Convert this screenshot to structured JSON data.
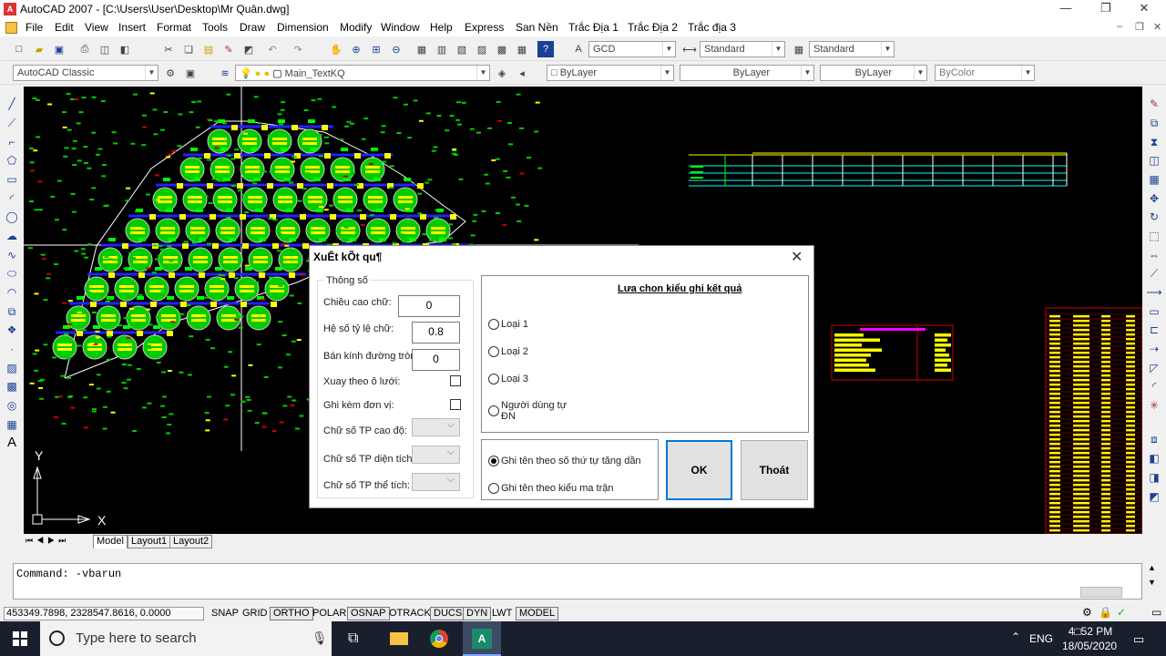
{
  "window": {
    "title": "AutoCAD 2007 - [C:\\Users\\User\\Desktop\\Mr Quân.dwg]",
    "min": "—",
    "restore": "❐",
    "close": "✕"
  },
  "menu": [
    "File",
    "Edit",
    "View",
    "Insert",
    "Format",
    "Tools",
    "Draw",
    "Dimension",
    "Modify",
    "Window",
    "Help",
    "Express",
    "San Nền",
    "Trắc Địa 1",
    "Trắc Địa 2",
    "Trắc địa 3"
  ],
  "toolbar": {
    "text_style": "GCD",
    "dim_style": "Standard",
    "table_style": "Standard",
    "workspace": "AutoCAD Classic",
    "layer": "Main_TextKQ",
    "color": "ByLayer",
    "linetype": "ByLayer",
    "lineweight": "ByLayer",
    "plotstyle": "ByColor"
  },
  "canvas": {
    "axis_y": "Y",
    "axis_x": "X"
  },
  "tabs": [
    "Model",
    "Layout1",
    "Layout2"
  ],
  "command": {
    "line": "Command: -vbarun"
  },
  "status": {
    "coords": "453349.7898, 2328547.8616, 0.0000",
    "buttons": [
      {
        "label": "SNAP",
        "on": false
      },
      {
        "label": "GRID",
        "on": false
      },
      {
        "label": "ORTHO",
        "on": true
      },
      {
        "label": "POLAR",
        "on": false
      },
      {
        "label": "OSNAP",
        "on": true
      },
      {
        "label": "OTRACK",
        "on": false
      },
      {
        "label": "DUCS",
        "on": true
      },
      {
        "label": "DYN",
        "on": true
      },
      {
        "label": "LWT",
        "on": false
      },
      {
        "label": "MODEL",
        "on": true
      }
    ]
  },
  "dialog": {
    "title": "XuÊt kÕt qu¶",
    "close": "✕",
    "group_params": "Thông số",
    "height_label": "Chiều cao chữ:",
    "height_value": "0",
    "ratio_label": "Hệ số tỷ lệ chữ:",
    "ratio_value": "0.8",
    "radius_label": "Bán kính đường tròn:",
    "radius_value": "0",
    "rotate_label": "Xuay theo ô lưới:",
    "unit_label": "Ghi kèm đơn vị:",
    "digits_elev_label": "Chữ số TP cao độ:",
    "digits_area_label": "Chữ số TP diện tích:",
    "digits_vol_label": "Chữ số TP thể tích:",
    "type_heading": "Lưa chon kiểu ghi kết quả",
    "types": [
      "Loại 1",
      "Loại 2",
      "Loại 3"
    ],
    "user_type": [
      "Người dùng tự",
      "ĐN"
    ],
    "order_asc": "Ghi tên theo số thứ tự tăng dần",
    "order_matrix": "Ghi tên theo kiểu ma trận",
    "ok": "OK",
    "exit": "Thoát"
  },
  "taskbar": {
    "search_placeholder": "Type here to search",
    "lang": "ENG",
    "time": "4□52 PM",
    "date": "18/05/2020"
  }
}
